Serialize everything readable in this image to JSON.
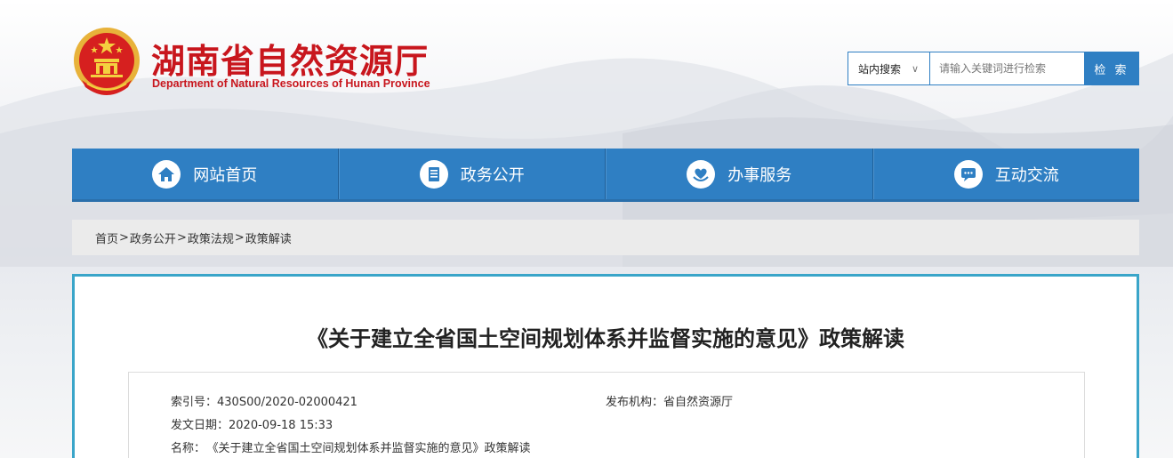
{
  "header": {
    "title": "湖南省自然资源厅",
    "subtitle": "Department of Natural Resources of Hunan Province"
  },
  "search": {
    "scope": "站内搜索",
    "placeholder": "请输入关键词进行检索",
    "button": "检 索"
  },
  "nav": {
    "items": [
      {
        "label": "网站首页",
        "icon": "home-icon"
      },
      {
        "label": "政务公开",
        "icon": "document-icon"
      },
      {
        "label": "办事服务",
        "icon": "heart-hand-icon"
      },
      {
        "label": "互动交流",
        "icon": "chat-icon"
      }
    ]
  },
  "breadcrumb": [
    "首页",
    "政务公开",
    "政策法规",
    "政策解读"
  ],
  "article": {
    "title": "《关于建立全省国土空间规划体系并监督实施的意见》政策解读",
    "meta": {
      "index_label": "索引号：",
      "index_value": "430S00/2020-02000421",
      "publisher_label": "发布机构：",
      "publisher_value": "省自然资源厅",
      "date_label": "发文日期：",
      "date_value": "2020-09-18 15:33",
      "name_label": "名称：",
      "name_value": "《关于建立全省国土空间规划体系并监督实施的意见》政策解读"
    }
  },
  "colors": {
    "brand_red": "#c8161d",
    "nav_blue": "#2f7fc3",
    "content_border": "#3aa5c9"
  }
}
